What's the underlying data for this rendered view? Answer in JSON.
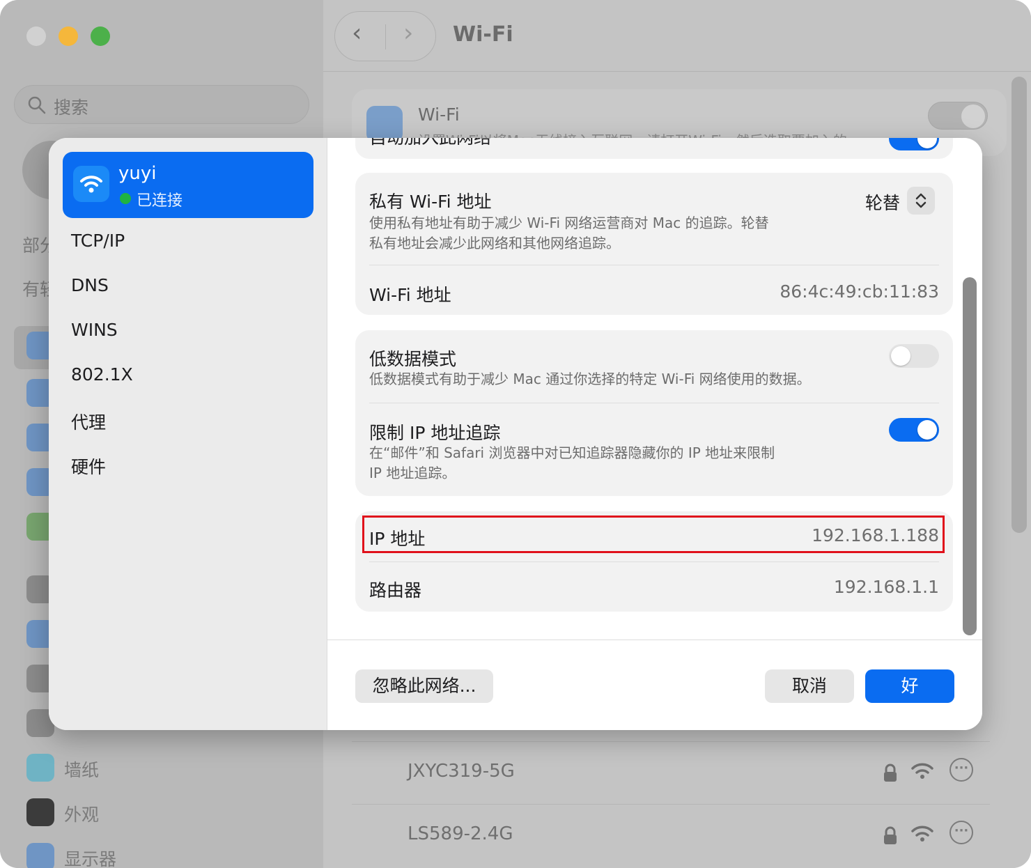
{
  "background": {
    "search_placeholder": "搜索",
    "window_title": "Wi-Fi",
    "sidebar_partial": [
      "部分",
      "有轻"
    ],
    "sidebar_items": [
      "墙纸",
      "外观",
      "显示器"
    ],
    "wifi_card": {
      "title": "Wi-Fi",
      "subtitle": "设置Wi-Fi以将Mac无线接入互联网。请打开Wi-Fi，然后选取要加入的..."
    },
    "networks": [
      {
        "name": "JXYC319-5G"
      },
      {
        "name": "LS589-2.4G"
      }
    ]
  },
  "dialog": {
    "network": {
      "name": "yuyi",
      "status": "已连接"
    },
    "tabs": [
      "TCP/IP",
      "DNS",
      "WINS",
      "802.1X",
      "代理",
      "硬件"
    ],
    "top_partial_label": "自动加入此网络",
    "private_address": {
      "title": "私有 Wi-Fi 地址",
      "value": "轮替",
      "desc_line1": "使用私有地址有助于减少 Wi-Fi 网络运营商对 Mac 的追踪。轮替",
      "desc_line2": "私有地址会减少此网络和其他网络追踪。"
    },
    "wifi_address": {
      "label": "Wi-Fi 地址",
      "value": "86:4c:49:cb:11:83"
    },
    "low_data": {
      "title": "低数据模式",
      "desc": "低数据模式有助于减少 Mac 通过你选择的特定 Wi-Fi 网络使用的数据。",
      "enabled": false
    },
    "limit_ip": {
      "title": "限制 IP 地址追踪",
      "desc_line1": "在“邮件”和 Safari 浏览器中对已知追踪器隐藏你的 IP 地址来限制",
      "desc_line2": "IP 地址追踪。",
      "enabled": true
    },
    "ip_address": {
      "label": "IP 地址",
      "value": "192.168.1.188"
    },
    "router": {
      "label": "路由器",
      "value": "192.168.1.1"
    },
    "buttons": {
      "forget": "忽略此网络...",
      "cancel": "取消",
      "ok": "好"
    }
  },
  "colors": {
    "accent": "#0a6cf1",
    "highlight": "#e0111b",
    "connected": "#1fb341"
  }
}
